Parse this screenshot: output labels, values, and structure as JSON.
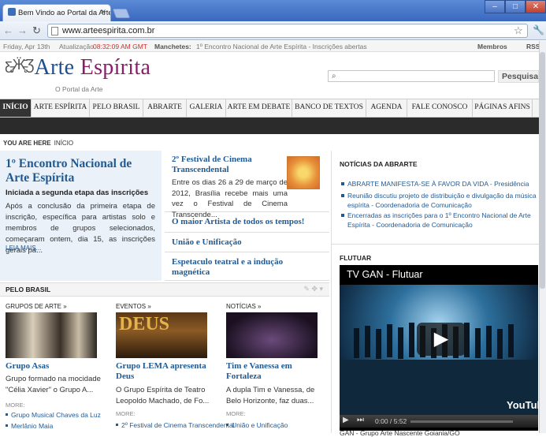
{
  "browser": {
    "tab_title": "Bem Vindo ao Portal da Arte E",
    "url": "www.arteespirita.com.br"
  },
  "infobar": {
    "date": "Friday, Apr 13th",
    "update_label": "Atualização",
    "time": "08:32:09 AM GMT",
    "headlines_label": "Manchetes:",
    "headline": "1º Encontro Nacional de Arte Espírita - Inscrições abertas",
    "members": "Membros",
    "rss": "RSS"
  },
  "logo": {
    "part1": "Arte ",
    "part2": "Espírita",
    "subtitle": "O Portal da Arte"
  },
  "search": {
    "button": "Pesquisa"
  },
  "menu": [
    "INÍCIO",
    "ARTE ESPÍRITA",
    "PELO BRASIL",
    "ABRARTE",
    "GALERIA",
    "ARTE EM DEBATE",
    "BANCO DE TEXTOS",
    "AGENDA",
    "FALE CONOSCO",
    "PÁGINAS AFINS"
  ],
  "breadcrumb": {
    "label": "YOU ARE HERE",
    "current": "INÍCIO"
  },
  "highlight": {
    "title": "1º Encontro Nacional de Arte Espírita",
    "subtitle": "Iniciada a segunda etapa das inscrições",
    "text": "Após a conclusão da primeira etapa de inscrição, específica para artistas solo e membros de grupos selecionados, começaram ontem, dia 15, as inscrições gerais pa...",
    "more": "LEIA MAIS..."
  },
  "center": {
    "festival_title": "2º Festival de Cinema Transcendental",
    "festival_text": "Entre os dias 26 a 29 de março de 2012, Brasília recebe mais uma vez o Festival de Cinema Transcende...",
    "item2": "O maior Artista de todos os tempos!",
    "item3": "União e Unificação",
    "item4": "Espetaculo teatral e a indução magnética"
  },
  "right": {
    "news_title": "NOTÍCIAS DA ABRARTE",
    "news": [
      "ABRARTE MANIFESTA-SE À FAVOR DA VIDA - Presidência",
      "Reunião discutiu projeto de distribuição e divulgação da música espírita - Coordenadoria de Comunicação",
      "Encerradas as inscrições para o 1º Encontro Nacional de Arte Espírita - Coordenadoria de Comunicação"
    ],
    "video_section": "FLUTUAR",
    "video_title": "TV GAN  -  Flutuar",
    "video_time": "0:00 / 5:52",
    "youtube": "YouTube",
    "video_caption": "GAN - Grupo Arte Nascente Goiania/GO"
  },
  "brasil": {
    "title": "PELO BRASIL",
    "cols": [
      {
        "section": "GRUPOS DE ARTE",
        "title": "Grupo Asas",
        "text": "Grupo formado na mocidade \"Célia Xavier\" o Grupo A...",
        "more": "MORE:",
        "links": [
          "Grupo Musical Chaves da Luz",
          "Merlânio Maia"
        ]
      },
      {
        "section": "EVENTOS",
        "title": "Grupo LEMA apresenta Deus",
        "text": "O Grupo Espírita de Teatro Leopoldo Machado, de Fo...",
        "more": "MORE:",
        "links": [
          "2º Festival de Cinema Transcendental"
        ]
      },
      {
        "section": "NOTÍCIAS",
        "title": "Tim e Vanessa em Fortaleza",
        "text": "A dupla Tim e Vanessa, de Belo Horizonte, faz duas...",
        "more": "MORE:",
        "links": [
          "União e Unificação"
        ]
      }
    ]
  },
  "colors": {
    "link": "#1f5a95",
    "brand_blue": "#1f4f8f",
    "brand_purple": "#8a1c6a"
  }
}
